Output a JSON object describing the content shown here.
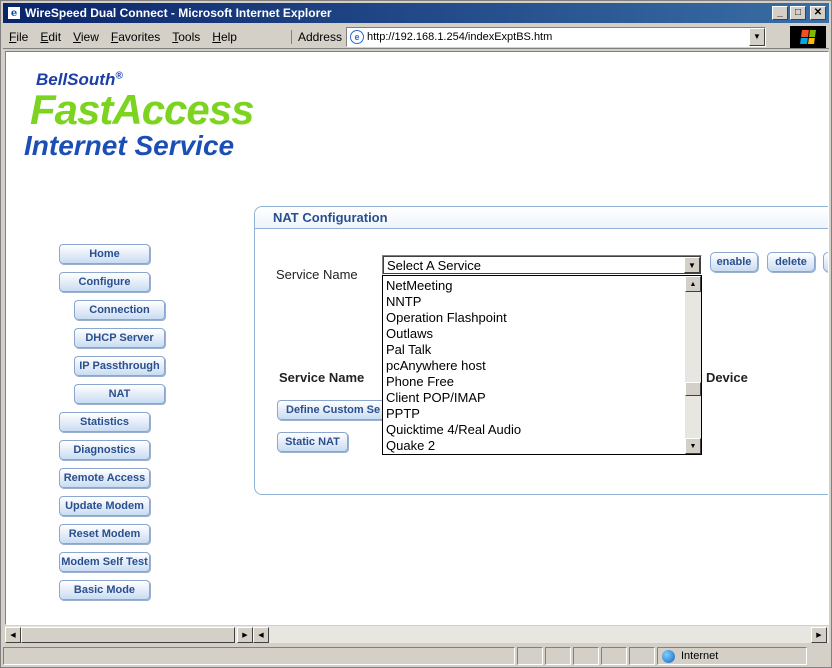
{
  "window": {
    "title": "WireSpeed Dual Connect - Microsoft Internet Explorer"
  },
  "menubar": {
    "items": [
      "File",
      "Edit",
      "View",
      "Favorites",
      "Tools",
      "Help"
    ],
    "address_label": "Address",
    "url": "http://192.168.1.254/indexExptBS.htm"
  },
  "logo": {
    "brand": "BellSouth",
    "reg": "®",
    "product": "FastAccess",
    "service": "Internet Service"
  },
  "nav": [
    {
      "label": "Home"
    },
    {
      "label": "Configure"
    },
    {
      "label": "Connection"
    },
    {
      "label": "DHCP Server"
    },
    {
      "label": "IP Passthrough"
    },
    {
      "label": "NAT"
    },
    {
      "label": "Statistics"
    },
    {
      "label": "Diagnostics"
    },
    {
      "label": "Remote Access"
    },
    {
      "label": "Update Modem"
    },
    {
      "label": "Reset Modem"
    },
    {
      "label": "Modem Self Test"
    },
    {
      "label": "Basic Mode"
    }
  ],
  "nat": {
    "title": "NAT Configuration",
    "service_label": "Service Name",
    "selected_service": "Select A Service",
    "enable_label": "enable",
    "delete_label": "delete",
    "col_service": "Service Name",
    "col_device": "t Device",
    "define_custom_label": "Define Custom Se",
    "static_nat_label": "Static NAT",
    "options": [
      "NetMeeting",
      "NNTP",
      "Operation Flashpoint",
      "Outlaws",
      "Pal Talk",
      "pcAnywhere host",
      "Phone Free",
      "Client POP/IMAP",
      "PPTP",
      "Quicktime 4/Real Audio",
      "Quake 2"
    ]
  },
  "status": {
    "zone": "Internet"
  },
  "colors": {
    "title_start": "#0a246a",
    "title_end": "#3a6ea5",
    "accent": "#2a4f8f",
    "logo_green": "#7cd320",
    "logo_blue": "#1b4fb6"
  }
}
